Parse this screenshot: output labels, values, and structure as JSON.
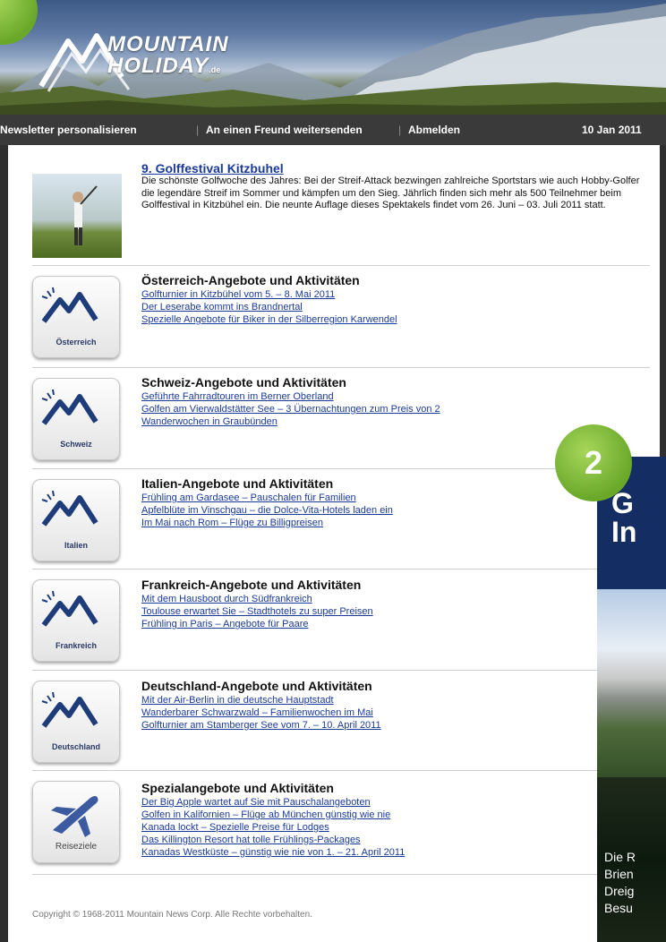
{
  "header": {
    "logo_line1": "MOUNTAIN",
    "logo_line2": "HOLIDAY",
    "logo_tld": ".de"
  },
  "nav": {
    "personalize": "Newsletter personalisieren",
    "forward": "An einen Freund weitersenden",
    "unsubscribe": "Abmelden",
    "date": "10 Jan 2011"
  },
  "feature": {
    "title": "9. Golffestival Kitzbuhel",
    "text": "Die schönste Golfwoche des Jahres: Bei der Streif-Attack bezwingen zahlreiche Sportstars wie auch Hobby-Golfer die legendäre Streif im Sommer und kämpfen um den Sieg. Jährlich finden sich mehr als 500 Teilnehmer beim Golffestival in Kitzbühel ein. Die neunte Auflage dieses Spektakels findet vom 26. Juni – 03. Juli 2011 statt."
  },
  "sections": [
    {
      "title": "Österreich-Angebote und Aktivitäten",
      "icon_label": "Österreich",
      "links": [
        "Golfturnier in Kitzbühel vom 5. – 8. Mai 2011",
        "Der Leserabe kommt ins Brandnertal",
        "Spezielle Angebote für Biker in der Silberregion Karwendel"
      ]
    },
    {
      "title": "Schweiz-Angebote und Aktivitäten",
      "icon_label": "Schweiz",
      "links": [
        "Geführte Fahrradtouren im Berner Oberland",
        "Golfen am Vierwaldstätter See – 3 Übernachtungen zum Preis von 2",
        "Wanderwochen in Graubünden"
      ]
    },
    {
      "title": "Italien-Angebote und Aktivitäten",
      "icon_label": "Italien",
      "links": [
        "Frühling am Gardasee – Pauschalen für Familien",
        "Apfelblüte im Vinschgau – die Dolce-Vita-Hotels laden ein",
        "Im Mai nach Rom – Flüge zu Billigpreisen"
      ]
    },
    {
      "title": "Frankreich-Angebote und Aktivitäten",
      "icon_label": "Frankreich",
      "links": [
        "Mit dem Hausboot durch Südfrankreich",
        "Toulouse erwartet Sie – Stadthotels zu super Preisen",
        "Frühling in Paris – Angebote für Paare"
      ]
    },
    {
      "title": "Deutschland-Angebote und Aktivitäten",
      "icon_label": "Deutschland",
      "links": [
        "Mit der Air-Berlin in die deutsche Hauptstadt",
        "Wanderbarer Schwarzwald – Familienwochen im Mai",
        "Golfturnier am Stamberger See vom 7. – 10. April 2011"
      ]
    },
    {
      "title": "Spezialangebote und Aktivitäten",
      "icon_label": "Reiseziele",
      "links": [
        "Der Big Apple wartet auf Sie mit Pauschalangeboten",
        "Golfen in Kalifornien – Flüge ab München günstig wie nie",
        "Kanada lockt – Spezielle Preise für Lodges",
        "Das Killington Resort hat tolle Frühlings-Packages",
        "Kanadas Westküste – günstig wie nie von 1. – 21. April 2011"
      ]
    }
  ],
  "copyright": "Copyright © 1968-2011 Mountain News Corp. Alle Rechte vorbehalten.",
  "callout": {
    "badge": "2",
    "ad_line1": "G",
    "ad_line2": "In",
    "caption_lines": [
      "Die R",
      "Brien",
      "Dreig",
      "Besu"
    ]
  },
  "colors": {
    "link": "#1a3a99",
    "nav_bg": "#3a3a3a",
    "badge_green": "#7ab83a",
    "ad_blue": "#142d63"
  }
}
